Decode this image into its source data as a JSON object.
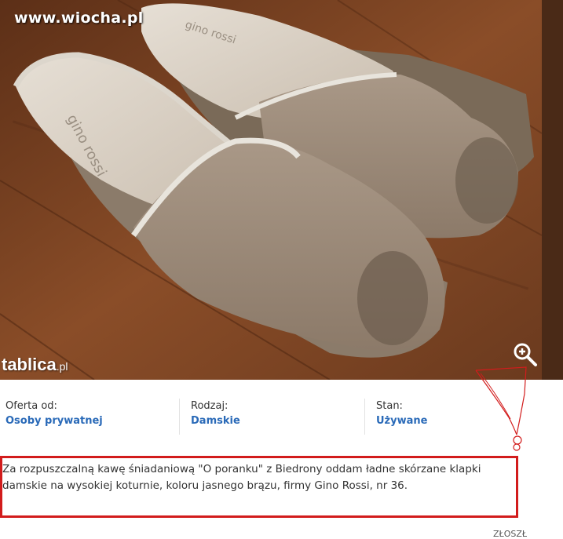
{
  "watermarks": {
    "site": "www.wiocha.pl",
    "marketplace": "tablica",
    "marketplace_suffix": ".pl"
  },
  "photo": {
    "shoe_brand_text": "gino rossi",
    "zoom_icon": "magnifier-plus-icon"
  },
  "details": [
    {
      "label": "Oferta od:",
      "value": "Osoby prywatnej"
    },
    {
      "label": "Rodzaj:",
      "value": "Damskie"
    },
    {
      "label": "Stan:",
      "value": "Używane"
    }
  ],
  "description": "Za rozpuszczalną kawę śniadaniową \"O poranku\" z Biedrony oddam ładne skórzane klapki damskie na wysokiej koturnie, koloru jasnego brązu, firmy Gino Rossi, nr 36.",
  "footer_partial": "ZŁOSZŁ",
  "colors": {
    "link_blue": "#2a6ab8",
    "highlight_red": "#d21c1c"
  }
}
